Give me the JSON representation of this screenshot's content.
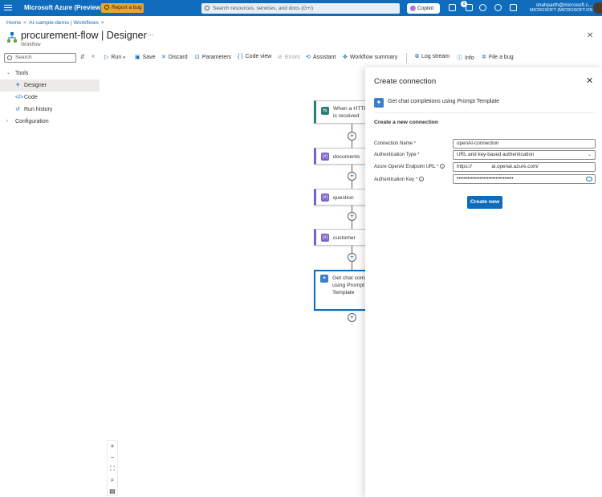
{
  "topbar": {
    "brand": "Microsoft Azure (Preview)",
    "report_bug": "Report a bug",
    "search_placeholder": "Search resources, services, and docs (G+/)",
    "copilot": "Copilot",
    "notification_count": "1",
    "user_name": "shahparth@microsoft.c...",
    "user_tenant": "MICROSOFT (MICROSOFT.ONMI..."
  },
  "breadcrumb": {
    "items": [
      "Home",
      "AI-sample-demo | Workflows"
    ],
    "separator": ">"
  },
  "page": {
    "title": "procurement-flow | Designer",
    "subtitle": "Workflow",
    "more": "···",
    "close": "✕"
  },
  "left": {
    "search_placeholder": "Search",
    "nav": {
      "tools": "Tools",
      "designer": "Designer",
      "code": "Code",
      "run_history": "Run history",
      "configuration": "Configuration"
    }
  },
  "toolbar": {
    "run": "Run",
    "save": "Save",
    "discard": "Discard",
    "parameters": "Parameters",
    "code_view": "Code view",
    "errors": "Errors",
    "assistant": "Assistant",
    "workflow_summary": "Workflow summary",
    "log_stream": "Log stream",
    "info": "Info",
    "file_bug": "File a bug"
  },
  "canvas": {
    "trigger": "When a HTTP is received",
    "documents": "documents",
    "question": "question",
    "customer": "customer",
    "selected": "Get chat comp using Prompt Template"
  },
  "panel": {
    "title": "Create connection",
    "action": "Get chat completions using Prompt Template",
    "subtitle": "Create a new connection",
    "connection_name_label": "Connection Name",
    "connection_name_value": "openAI-connection",
    "auth_type_label": "Authentication Type",
    "auth_type_value": "URL and key-based authentication",
    "endpoint_label": "Azure OpenAI Endpoint URL",
    "endpoint_value": "https://              ai.openai.azure.com/",
    "auth_key_label": "Authentication Key",
    "auth_key_value": "••••••••••••••••••••••••••••••••",
    "required_mark": "*",
    "create_button": "Create new"
  },
  "colors": {
    "topbar": "#0f6cbd",
    "bug_badge": "#e7a532",
    "accent": "#0f6cbd",
    "variable_action": "#7b61c9",
    "trigger_action": "#2e7d7a"
  }
}
